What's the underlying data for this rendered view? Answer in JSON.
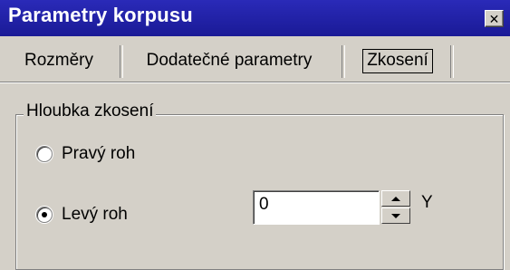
{
  "window": {
    "title": "Parametry korpusu",
    "close_glyph": "✕",
    "close_icon": "close-icon"
  },
  "tabs": [
    {
      "label": "Rozměry",
      "active": false
    },
    {
      "label": "Dodatečné parametry",
      "active": false
    },
    {
      "label": "Zkosení",
      "active": true
    }
  ],
  "group": {
    "title": "Hloubka zkosení",
    "options": [
      {
        "label": "Pravý roh",
        "checked": false
      },
      {
        "label": "Levý roh",
        "checked": true
      }
    ],
    "value_field": {
      "value": "0",
      "unit": "Y"
    }
  },
  "colors": {
    "titlebar": "#1f1fa0",
    "face": "#d4d0c8"
  }
}
